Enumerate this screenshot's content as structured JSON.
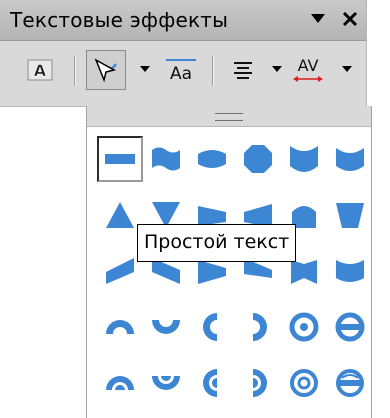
{
  "window": {
    "title": "Текстовые эффекты",
    "menu_icon": "triangle-down-icon",
    "close_icon": "close-icon"
  },
  "toolbar": {
    "items": [
      {
        "name": "fontwork-style-button",
        "icon": "letter-a-frame-icon",
        "letter": "A"
      },
      {
        "name": "fontwork-shape-button",
        "icon": "shape-select-icon",
        "pressed": true,
        "has_dropdown": true
      },
      {
        "name": "same-letter-heights-button",
        "icon": "same-height-icon",
        "letters": "Aa"
      },
      {
        "name": "alignment-button",
        "icon": "align-center-icon",
        "has_dropdown": true
      },
      {
        "name": "character-spacing-button",
        "icon": "character-spacing-icon",
        "letters": "AV",
        "has_dropdown": true
      }
    ]
  },
  "gallery": {
    "accent": "#3d86d3",
    "rows": [
      [
        "plain-text",
        "wave",
        "inflate",
        "octagon",
        "triangle-up-curve",
        "cup"
      ],
      [
        "triangle-up",
        "triangle-down",
        "slant-right",
        "slant-left",
        "arch-pillar",
        "trapezoid"
      ],
      [
        "slant-up",
        "slant-down",
        "cascade-right",
        "cascade-left",
        "banner",
        "curve-down"
      ],
      [
        "arch-up",
        "arch-down",
        "circle-left",
        "circle-right",
        "ring",
        "button"
      ],
      [
        "arch-up-pour",
        "arch-down-pour",
        "circle-left-pour",
        "circle-right-pour",
        "ring-pour",
        "button-pour"
      ]
    ],
    "selected": "plain-text"
  },
  "tooltip": {
    "text": "Простой текст"
  }
}
